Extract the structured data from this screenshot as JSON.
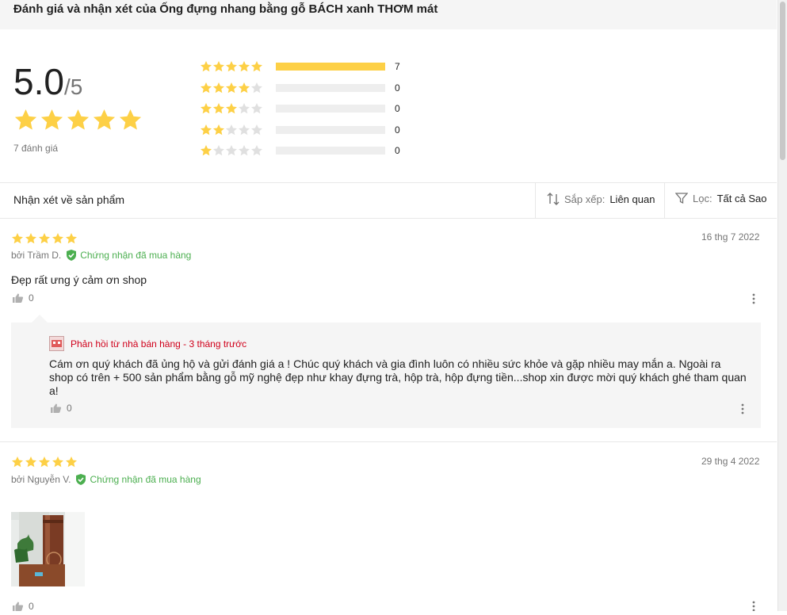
{
  "page": {
    "title": "Đánh giá và nhận xét của Ống đựng nhang bằng gỗ BÁCH xanh THƠM mát"
  },
  "summary": {
    "average": "5.0",
    "out_of": "/5",
    "total_label": "7 đánh giá",
    "average_stars": 5,
    "distribution": [
      {
        "stars": 5,
        "count": "7",
        "fraction": 1.0
      },
      {
        "stars": 4,
        "count": "0",
        "fraction": 0
      },
      {
        "stars": 3,
        "count": "0",
        "fraction": 0
      },
      {
        "stars": 2,
        "count": "0",
        "fraction": 0
      },
      {
        "stars": 1,
        "count": "0",
        "fraction": 0
      }
    ]
  },
  "filters": {
    "section_label": "Nhận xét về sản phẩm",
    "sort_label": "Sắp xếp:",
    "sort_value": "Liên quan",
    "filter_label": "Lọc:",
    "filter_value": "Tất cả Sao"
  },
  "reviews": [
    {
      "stars": 5,
      "date": "16 thg 7 2022",
      "author": "bởi Trầm D.",
      "verified": "Chứng nhận đã mua hàng",
      "content": "Đẹp rất ưng ý cảm ơn shop",
      "likes": "0",
      "reply": {
        "header": "Phản hồi từ nhà bán hàng - 3 tháng trước",
        "content": "Cám ơn quý khách đã ủng hộ và gửi đánh giá a ! Chúc quý khách và gia đình luôn có nhiều sức khỏe và gặp nhiều may mắn a. Ngoài ra shop có trên + 500 sản phẩm bằng gỗ mỹ nghệ đẹp như khay đựng trà, hộp trà, hộp đựng tiền...shop xin được mời quý khách ghé tham quan a!",
        "likes": "0"
      }
    },
    {
      "stars": 5,
      "date": "29 thg 4 2022",
      "author": "bởi Nguyễn V.",
      "verified": "Chứng nhận đã mua hàng",
      "likes": "0"
    }
  ],
  "colors": {
    "star": "#fdd046",
    "star_empty": "#e0e0e0",
    "verified": "#4caf50",
    "reply_header": "#d0011b"
  }
}
